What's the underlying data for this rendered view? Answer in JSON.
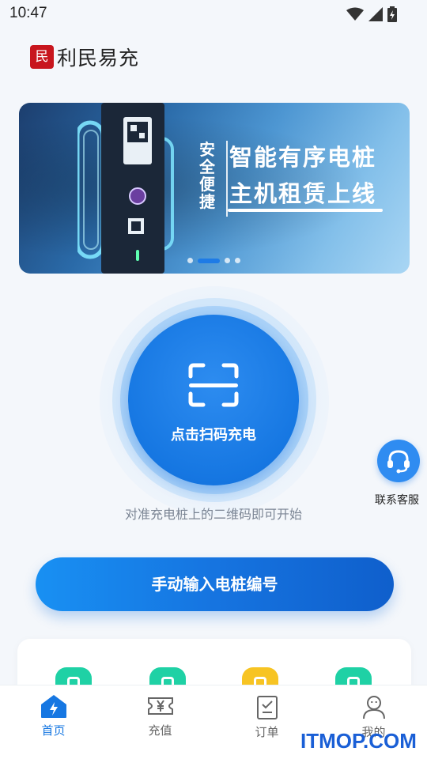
{
  "status_bar": {
    "time": "10:47",
    "icons": [
      "wifi-icon",
      "cellular-icon",
      "battery-charging-icon"
    ]
  },
  "brand": {
    "seal_text": "民",
    "name": "利民易充"
  },
  "banner": {
    "side_text": "安全便捷",
    "line1": "智能有序电桩",
    "line2": "主机租赁上线",
    "slide_count": 4,
    "active_slide": 1
  },
  "scan": {
    "label": "点击扫码充电",
    "hint": "对准充电桩上的二维码即可开始",
    "icon": "scan-frame-icon"
  },
  "customer_service": {
    "label": "联系客服",
    "icon": "headset-icon"
  },
  "manual_entry": {
    "label": "手动输入电桩编号"
  },
  "services": [
    {
      "icon": "service-icon-1",
      "color": "#1fd1a5"
    },
    {
      "icon": "service-icon-2",
      "color": "#1fd1a5"
    },
    {
      "icon": "service-icon-3",
      "color": "#f7c423"
    },
    {
      "icon": "service-icon-4",
      "color": "#1fd1a5"
    }
  ],
  "tabs": [
    {
      "label": "首页",
      "icon": "home-bolt-icon",
      "active": true
    },
    {
      "label": "充值",
      "icon": "recharge-ticket-icon",
      "active": false
    },
    {
      "label": "订单",
      "icon": "order-clipboard-icon",
      "active": false
    },
    {
      "label": "我的",
      "icon": "user-icon",
      "active": false
    }
  ],
  "colors": {
    "primary": "#1677e2",
    "accent_red": "#c8161e",
    "background": "#f4f7fb"
  },
  "watermark": "ITMOP.COM"
}
